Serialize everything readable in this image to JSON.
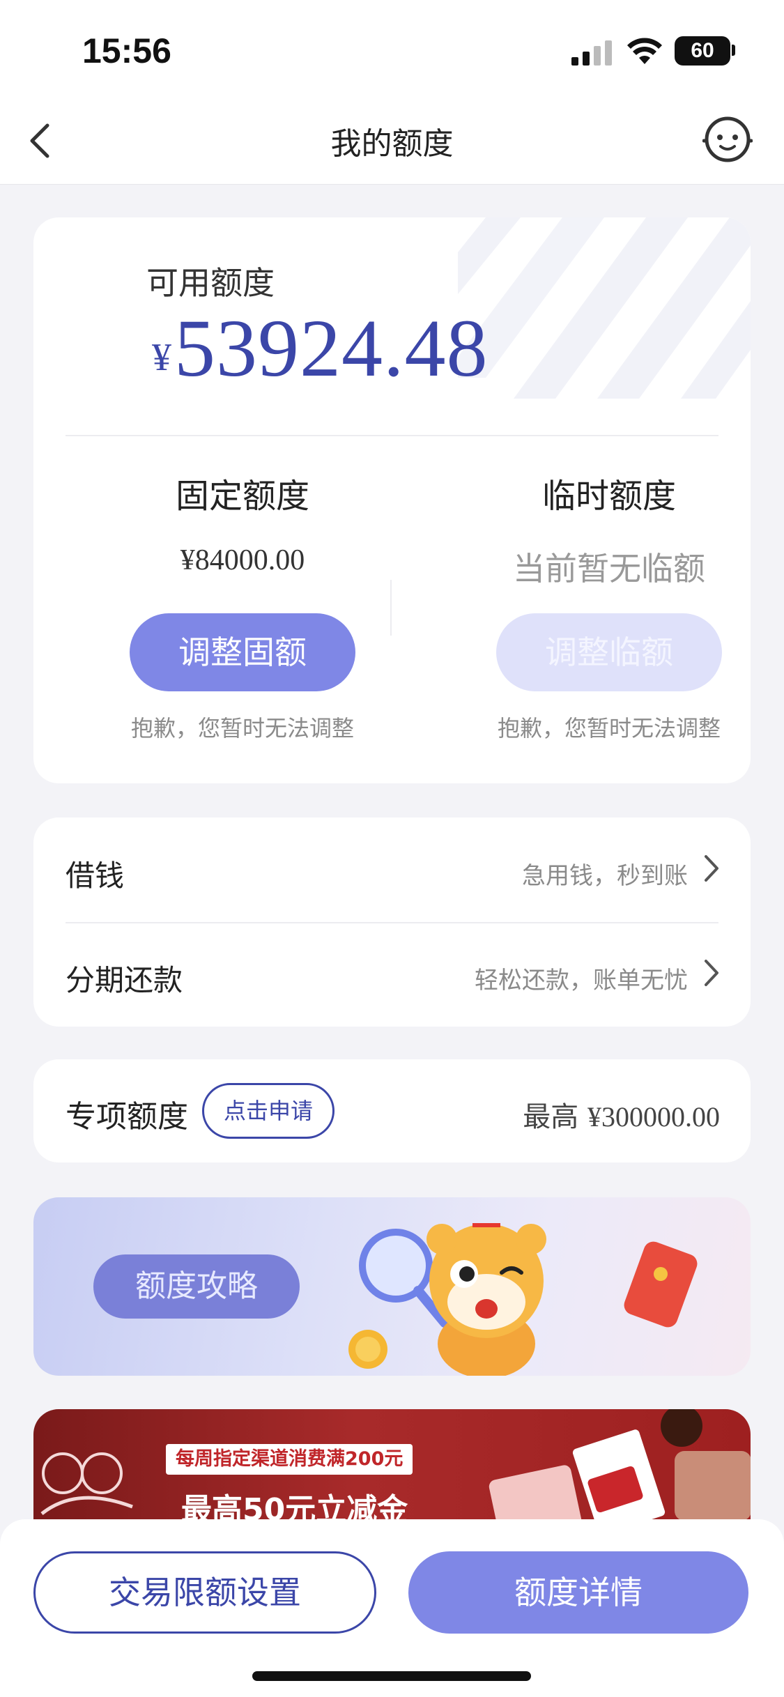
{
  "status_bar": {
    "time": "15:56",
    "battery": "60"
  },
  "nav": {
    "title": "我的额度",
    "back_icon": "chevron-left-icon",
    "service_icon": "customer-service-icon"
  },
  "credit": {
    "available_label": "可用额度",
    "currency": "¥",
    "available_amount": "53924.48",
    "fixed": {
      "title": "固定额度",
      "value": "¥84000.00",
      "button": "调整固额",
      "note": "抱歉，您暂时无法调整"
    },
    "temporary": {
      "title": "临时额度",
      "value": "当前暂无临额",
      "button": "调整临额",
      "note": "抱歉，您暂时无法调整"
    }
  },
  "menu": [
    {
      "label": "借钱",
      "hint": "急用钱，秒到账"
    },
    {
      "label": "分期还款",
      "hint": "轻松还款，账单无忧"
    }
  ],
  "special": {
    "label": "专项额度",
    "apply_button": "点击申请",
    "max_prefix": "最高",
    "max_value": "¥300000.00"
  },
  "guide_banner": {
    "pill": "额度攻略"
  },
  "promo_banner": {
    "tag": "每周指定渠道消费满200元",
    "headline": "最高50元立减金"
  },
  "bottom": {
    "limit_button": "交易限额设置",
    "detail_button": "额度详情"
  },
  "colors": {
    "accent": "#3b46a8",
    "button": "#7f87e6",
    "button_disabled": "#dfe1fa",
    "background": "#f3f3f7"
  }
}
